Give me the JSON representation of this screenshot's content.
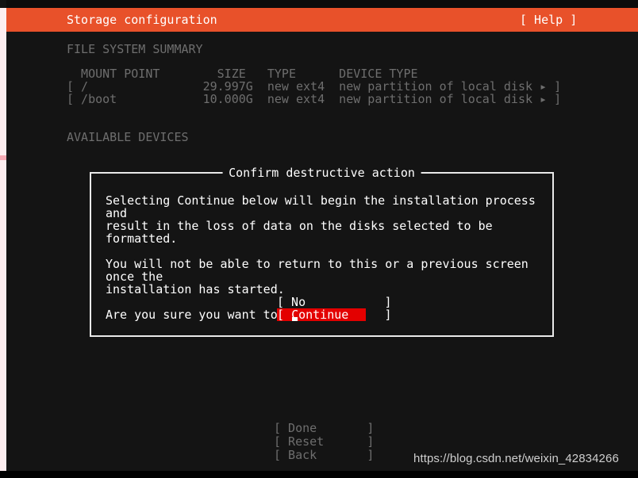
{
  "header": {
    "title": "Storage configuration",
    "help_label": "[ Help ]",
    "background": "#e8512a",
    "foreground": "#ffffff"
  },
  "sections": {
    "file_system_summary_heading": "FILE SYSTEM SUMMARY",
    "available_devices_heading": "AVAILABLE DEVICES"
  },
  "file_system_table": {
    "columns_line": "  MOUNT POINT        SIZE   TYPE      DEVICE TYPE",
    "headers": [
      "MOUNT POINT",
      "SIZE",
      "TYPE",
      "DEVICE TYPE"
    ],
    "rows": [
      {
        "line": "[ /                29.997G  new ext4  new partition of local disk ▸ ]",
        "mount_point": "/",
        "size": "29.997G",
        "type": "new ext4",
        "device_type": "new partition of local disk",
        "expander_icon": "▸"
      },
      {
        "line": "[ /boot            10.000G  new ext4  new partition of local disk ▸ ]",
        "mount_point": "/boot",
        "size": "10.000G",
        "type": "new ext4",
        "device_type": "new partition of local disk",
        "expander_icon": "▸"
      }
    ]
  },
  "dialog": {
    "title": "Confirm destructive action",
    "paragraph_1": "Selecting Continue below will begin the installation process and\nresult in the loss of data on the disks selected to be formatted.",
    "paragraph_2": "You will not be able to return to this or a previous screen once the\ninstallation has started.",
    "paragraph_3": "Are you sure you want to continue?",
    "choices": [
      {
        "label": "[ No           ]",
        "text": "No",
        "selected": false
      },
      {
        "label": "[ Continue     ]",
        "text": "Continue",
        "selected": true
      }
    ],
    "selected_background": "#e30000",
    "selected_foreground": "#ffffff",
    "border_color": "#e9e9e9"
  },
  "footer_buttons": [
    "[ Done       ]",
    "[ Reset      ]",
    "[ Back       ]"
  ],
  "watermark": "https://blog.csdn.net/weixin_42834266"
}
